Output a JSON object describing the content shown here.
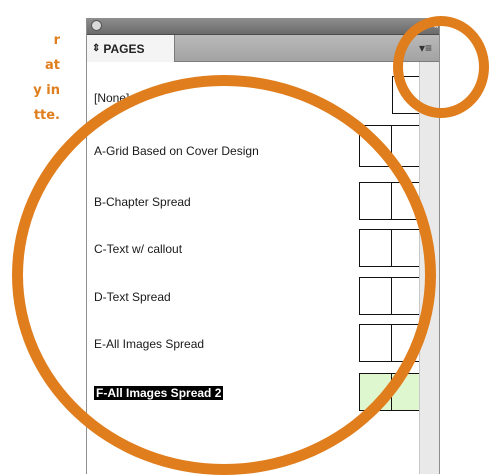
{
  "side_text": [
    "r",
    "at",
    "y in",
    "tte."
  ],
  "panel": {
    "collapse_glyph": "◂◂",
    "tab_icon": "updown-arrows-icon",
    "tab_label": "PAGES",
    "menu_glyph": "▾≡",
    "rows": [
      {
        "label": "[None]",
        "thumb": "single"
      },
      {
        "label": "A-Grid Based on Cover Design",
        "thumb": "spread"
      },
      {
        "label": "B-Chapter Spread",
        "thumb": "spread"
      },
      {
        "label": "C-Text w/ callout",
        "thumb": "spread"
      },
      {
        "label": "D-Text Spread",
        "thumb": "spread"
      },
      {
        "label": "E-All Images Spread",
        "thumb": "spread"
      },
      {
        "label": "F-All Images Spread 2",
        "thumb": "spread",
        "selected": true
      }
    ]
  },
  "colors": {
    "annotation": "#e07d1c",
    "selected_thumb": "#dff7cf"
  }
}
